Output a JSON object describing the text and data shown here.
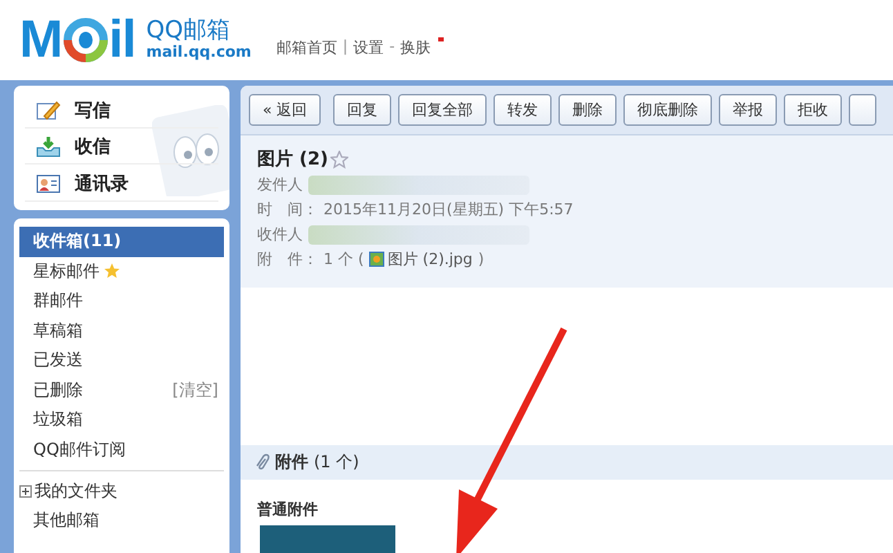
{
  "header": {
    "logo_left": "M",
    "logo_right": "il",
    "brand": "QQ邮箱",
    "domain": "mail.qq.com",
    "nav": [
      {
        "label": "邮箱首页",
        "kind": "link"
      },
      {
        "label": "|",
        "kind": "sep"
      },
      {
        "label": "设置",
        "kind": "link"
      },
      {
        "label": "-",
        "kind": "sep"
      },
      {
        "label": "换肤",
        "kind": "link",
        "new": true
      }
    ]
  },
  "quick_actions": [
    {
      "label": "写信",
      "kind": "compose"
    },
    {
      "label": "收信",
      "kind": "receive"
    },
    {
      "label": "通讯录",
      "kind": "contacts"
    }
  ],
  "folders": [
    {
      "label": "收件箱(11)",
      "selected": true,
      "starred": false
    },
    {
      "label": "星标邮件",
      "selected": false,
      "starred": true
    },
    {
      "label": "群邮件",
      "selected": false,
      "starred": false
    },
    {
      "label": "草稿箱",
      "selected": false,
      "starred": false
    },
    {
      "label": "已发送",
      "selected": false,
      "starred": false
    },
    {
      "label": "已删除",
      "selected": false,
      "starred": false,
      "action": "[清空]"
    },
    {
      "label": "垃圾箱",
      "selected": false,
      "starred": false
    },
    {
      "label": "QQ邮件订阅",
      "selected": false,
      "starred": false
    }
  ],
  "folder_groups": [
    {
      "label": "我的文件夹",
      "expandable": true
    },
    {
      "label": "其他邮箱",
      "expandable": false
    }
  ],
  "toolbar": [
    {
      "label": "« 返回",
      "kind": "back"
    },
    {
      "label": "回复",
      "kind": "action"
    },
    {
      "label": "回复全部",
      "kind": "action"
    },
    {
      "label": "转发",
      "kind": "action"
    },
    {
      "label": "删除",
      "kind": "action"
    },
    {
      "label": "彻底删除",
      "kind": "action"
    },
    {
      "label": "举报",
      "kind": "action"
    },
    {
      "label": "拒收",
      "kind": "action"
    },
    {
      "kind": "cut"
    }
  ],
  "email": {
    "subject": "图片 (2)",
    "starred": false,
    "fields": [
      {
        "label": "发件人",
        "kind": "hidden"
      },
      {
        "label": "时　间：",
        "kind": "text",
        "value": "2015年11月20日(星期五) 下午5:57"
      },
      {
        "label": "收件人",
        "kind": "hidden"
      },
      {
        "label": "附　件：",
        "kind": "file",
        "value": "1 个 (",
        "file": "图片 (2).jpg",
        "after": ")"
      }
    ]
  },
  "attachments": {
    "title": "附件",
    "count": "(1 个)",
    "section": "普通附件"
  }
}
